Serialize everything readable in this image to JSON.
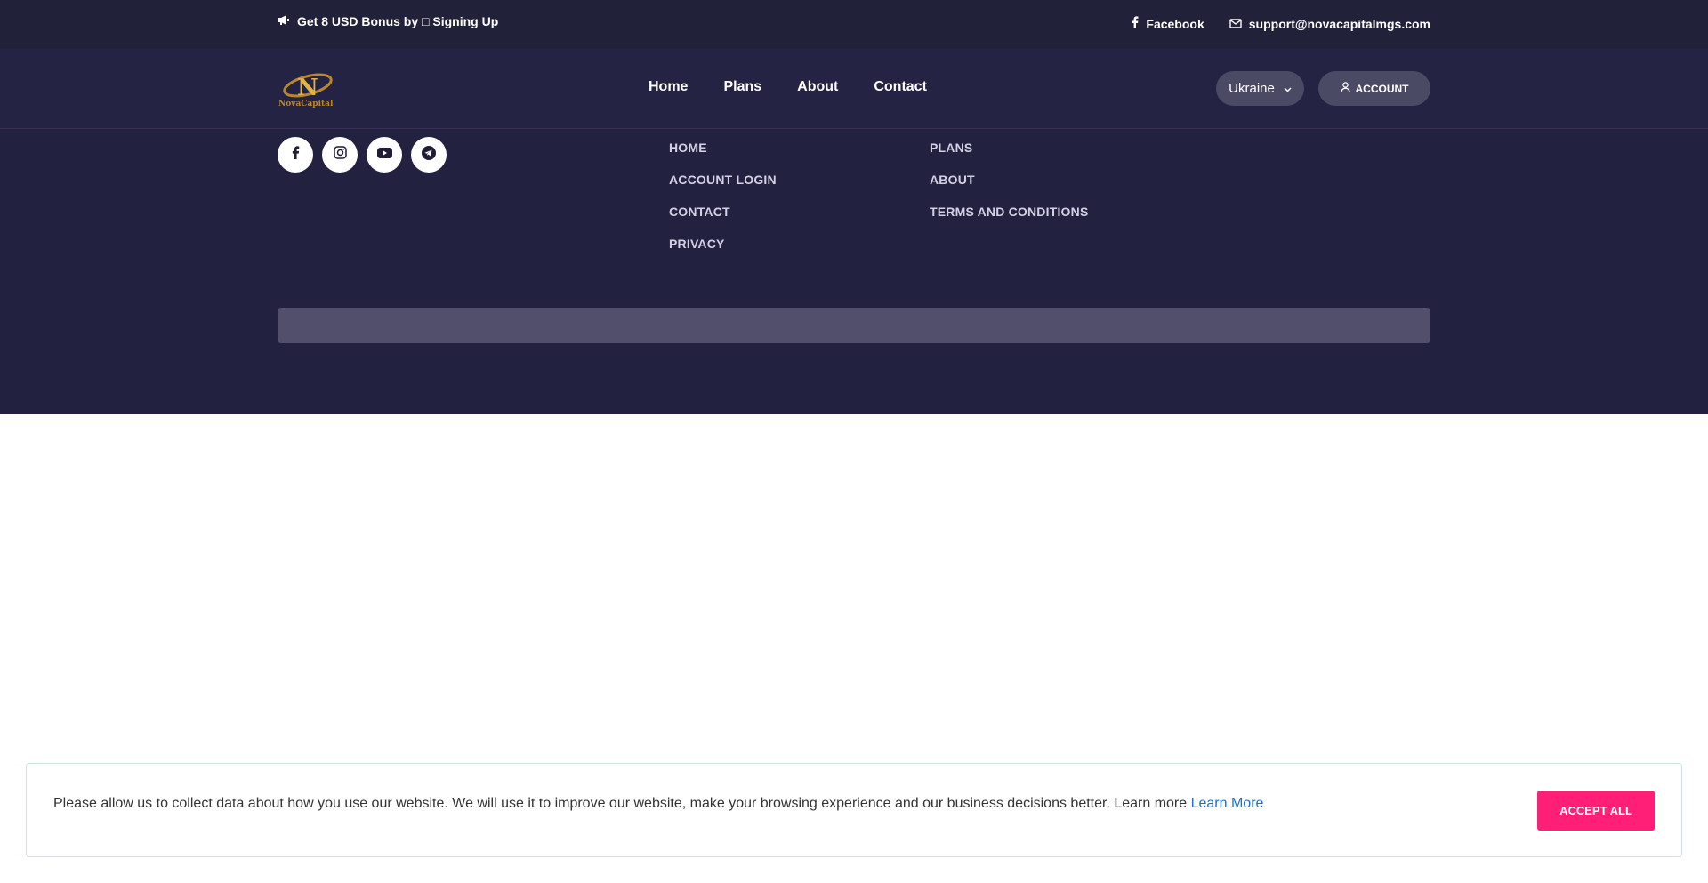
{
  "topbar": {
    "promo_text": "Get 8 USD Bonus by □ Signing Up",
    "facebook_label": "Facebook",
    "email": "support@novacapitalmgs.com"
  },
  "header": {
    "logo_text": "NovaCapital",
    "logo_letter": "N",
    "nav": [
      "Home",
      "Plans",
      "About",
      "Contact"
    ],
    "country_selected": "Ukraine",
    "account_label": "ACCOUNT"
  },
  "footer": {
    "links_col1": [
      "HOME",
      "ACCOUNT LOGIN",
      "CONTACT",
      "PRIVACY"
    ],
    "links_col2": [
      "PLANS",
      "ABOUT",
      "TERMS AND CONDITIONS"
    ],
    "socials": [
      "facebook-icon",
      "instagram-icon",
      "youtube-icon",
      "telegram-icon"
    ]
  },
  "cookie": {
    "message": "Please allow us to collect data about how you use our website. We will use it to improve our website, make your browsing experience and our business decisions better. Learn more ",
    "learn_more": "Learn More",
    "accept_label": "ACCEPT ALL"
  },
  "colors": {
    "topbar_bg": "#22213a",
    "footer_bg": "#232140",
    "accent": "#ff1f77",
    "link": "#1a73c8"
  }
}
